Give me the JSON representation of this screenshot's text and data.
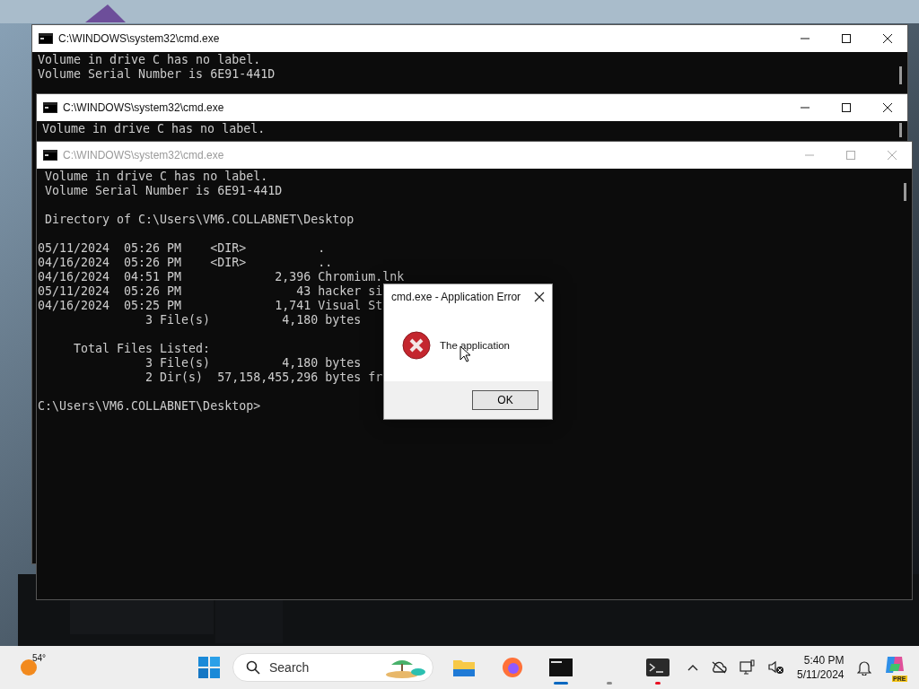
{
  "windows": [
    {
      "title": "C:\\WINDOWS\\system32\\cmd.exe",
      "active": true,
      "blocks": [
        [
          "Volume in drive C has no label.",
          "Volume Serial Number is 6E91-441D"
        ]
      ]
    },
    {
      "title": "C:\\WINDOWS\\system32\\cmd.exe",
      "active": true,
      "blocks": [
        [
          "Volume in drive C has no label."
        ]
      ]
    },
    {
      "title": "C:\\WINDOWS\\system32\\cmd.exe",
      "active": false,
      "blocks": [
        [
          " Volume in drive C has no label.",
          " Volume Serial Number is 6E91-441D"
        ],
        [
          " Directory of C:\\Users\\VM6.COLLABNET\\Desktop"
        ],
        [
          "05/11/2024  05:26 PM    <DIR>          .",
          "04/16/2024  05:26 PM    <DIR>          ..",
          "04/16/2024  04:51 PM             2,396 Chromium.lnk",
          "05/11/2024  05:26 PM                43 hacker si",
          "04/16/2024  05:25 PM             1,741 Visual St",
          "               3 File(s)          4,180 bytes"
        ],
        [
          "     Total Files Listed:",
          "               3 File(s)          4,180 bytes",
          "               2 Dir(s)  57,158,455,296 bytes fr"
        ],
        [
          "C:\\Users\\VM6.COLLABNET\\Desktop>"
        ]
      ]
    }
  ],
  "dialog": {
    "title": "cmd.exe - Application Error",
    "message": "The application",
    "button": "OK"
  },
  "taskbar": {
    "weather": "54°",
    "search": {
      "placeholder": "Search"
    },
    "apps": [
      {
        "kind": "folder"
      },
      {
        "kind": "browser"
      },
      {
        "kind": "console",
        "color": "#0067c0"
      },
      {
        "kind": "blank",
        "color": "#8a8a8a"
      },
      {
        "kind": "terminal",
        "color": "#e81123"
      }
    ],
    "tray": [
      {
        "kind": "chevron"
      },
      {
        "kind": "cloud-off"
      },
      {
        "kind": "monitor"
      },
      {
        "kind": "speaker-muted"
      }
    ],
    "time": "5:40 PM",
    "date": "5/11/2024",
    "badge": "PRE"
  }
}
